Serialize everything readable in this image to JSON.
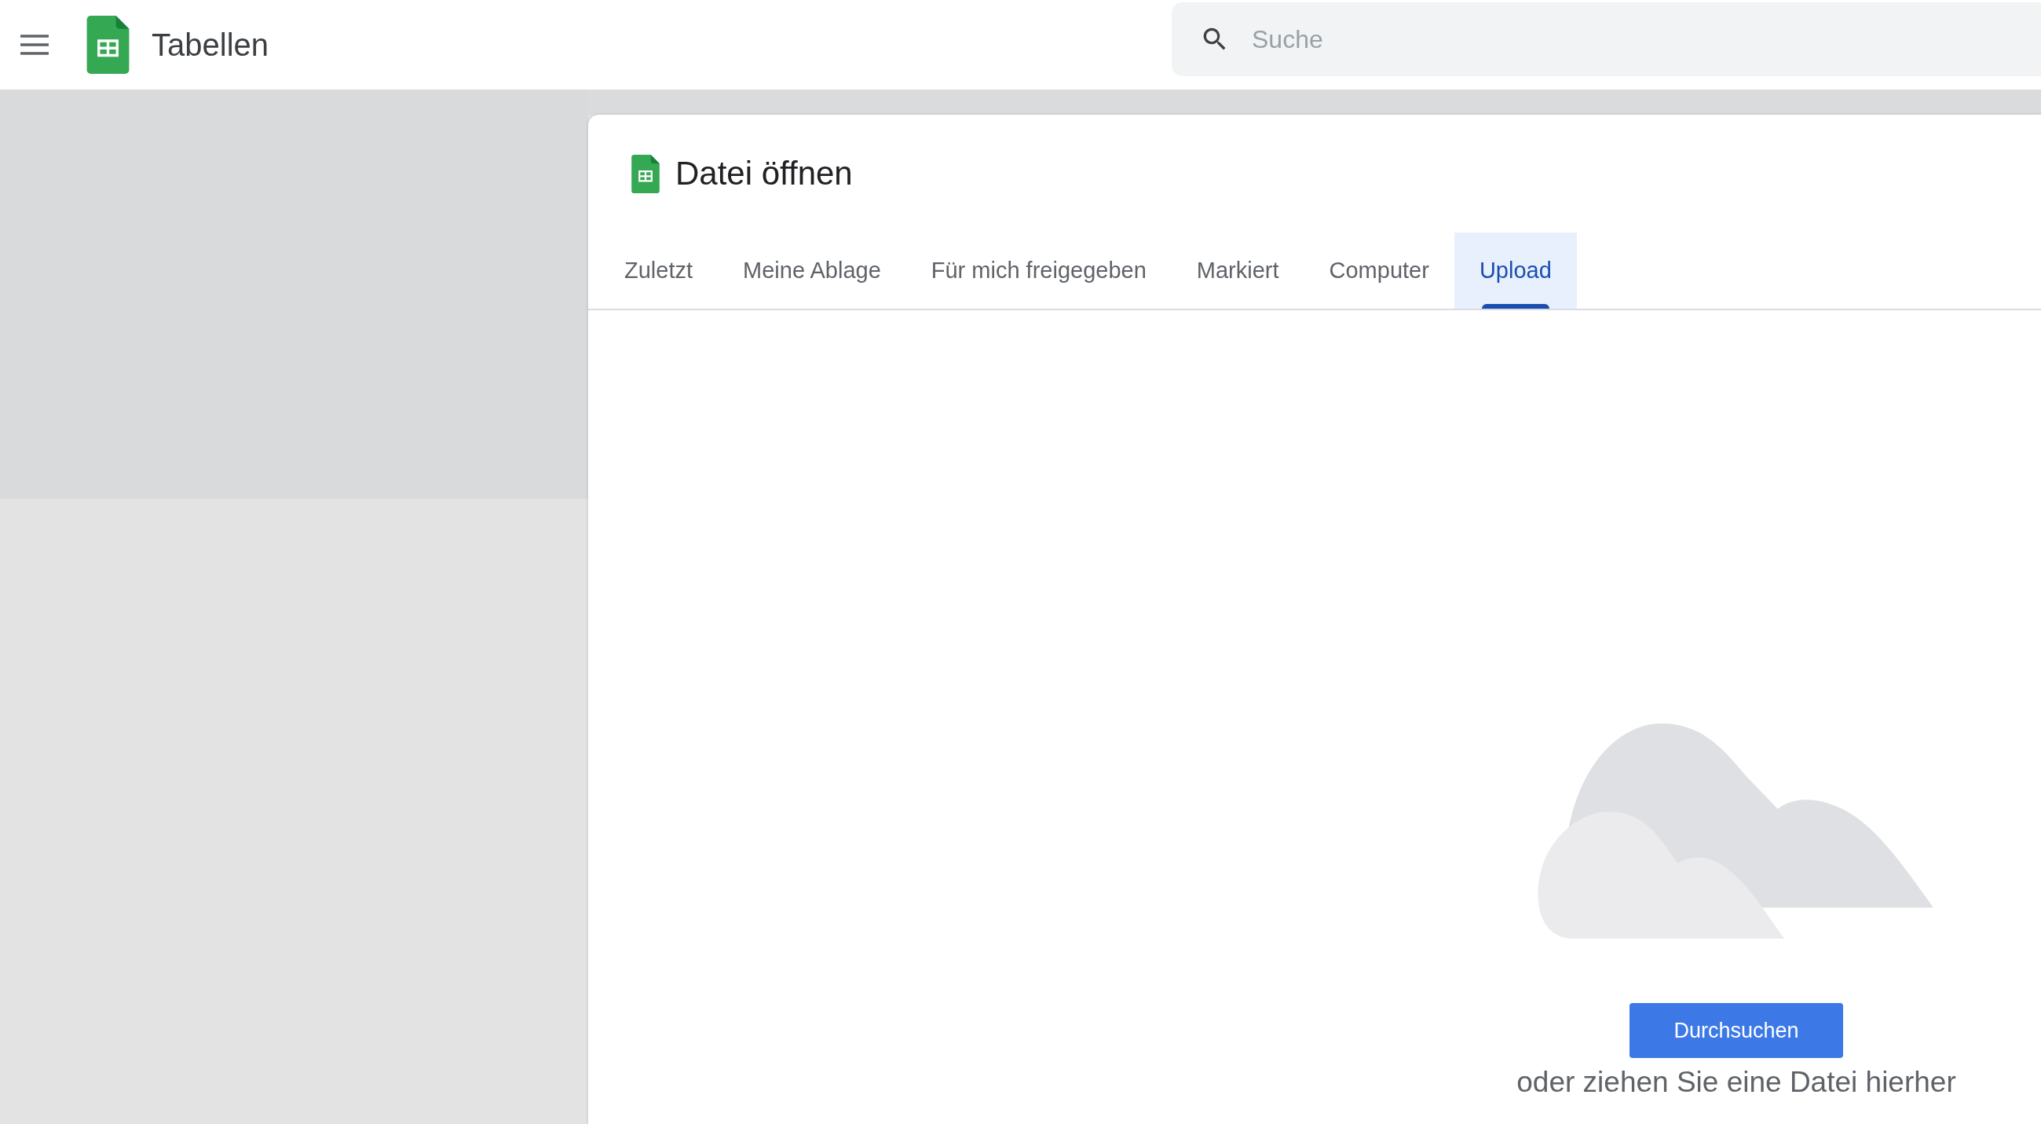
{
  "app": {
    "title": "Tabellen"
  },
  "search": {
    "placeholder": "Suche"
  },
  "dialog": {
    "title": "Datei öffnen",
    "tabs": [
      {
        "label": "Zuletzt",
        "selected": false
      },
      {
        "label": "Meine Ablage",
        "selected": false
      },
      {
        "label": "Für mich freigegeben",
        "selected": false
      },
      {
        "label": "Markiert",
        "selected": false
      },
      {
        "label": "Computer",
        "selected": false
      },
      {
        "label": "Upload",
        "selected": true
      }
    ],
    "upload": {
      "button": "Durchsuchen",
      "hint": "oder ziehen Sie eine Datei hierher"
    }
  }
}
